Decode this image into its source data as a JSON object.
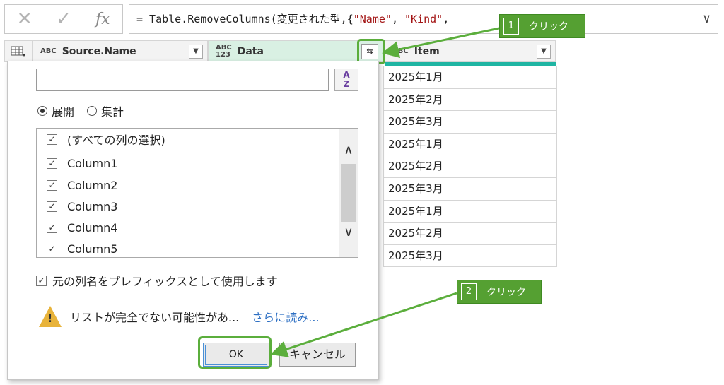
{
  "formula_bar": {
    "cancel_icon": "close-icon",
    "confirm_icon": "check-icon",
    "fx_label": "fx",
    "formula_prefix": "= Table.RemoveColumns(変更された型,{",
    "formula_str1": "\"Name\"",
    "formula_sep": ", ",
    "formula_str2": "\"Kind\"",
    "formula_suffix": ",",
    "expand_icon": "chevron-down-icon"
  },
  "columns": [
    {
      "type_icon": "ABC",
      "name": "Source.Name"
    },
    {
      "type_icon_top": "ABC",
      "type_icon_bottom": "123",
      "name": "Data"
    },
    {
      "type_icon": "ABC",
      "name": "Item"
    }
  ],
  "items": [
    "2025年1月",
    "2025年2月",
    "2025年3月",
    "2025年1月",
    "2025年2月",
    "2025年3月",
    "2025年1月",
    "2025年2月",
    "2025年3月"
  ],
  "panel": {
    "search_placeholder": "",
    "sort_top": "A",
    "sort_bottom": "Z",
    "radio_expand": "展開",
    "radio_aggregate": "集計",
    "list": [
      "(すべての列の選択)",
      "Column1",
      "Column2",
      "Column3",
      "Column4",
      "Column5"
    ],
    "use_prefix": "元の列名をプレフィックスとして使用します",
    "warning": "リストが完全でない可能性があ...",
    "load_more": "さらに読み...",
    "ok": "OK",
    "cancel": "キャンセル"
  },
  "callouts": [
    {
      "num": "1",
      "text": "クリック"
    },
    {
      "num": "2",
      "text": "クリック"
    }
  ],
  "colors": {
    "highlight": "#5bae3c",
    "callout": "#55a032",
    "teal": "#1fb5a3"
  }
}
